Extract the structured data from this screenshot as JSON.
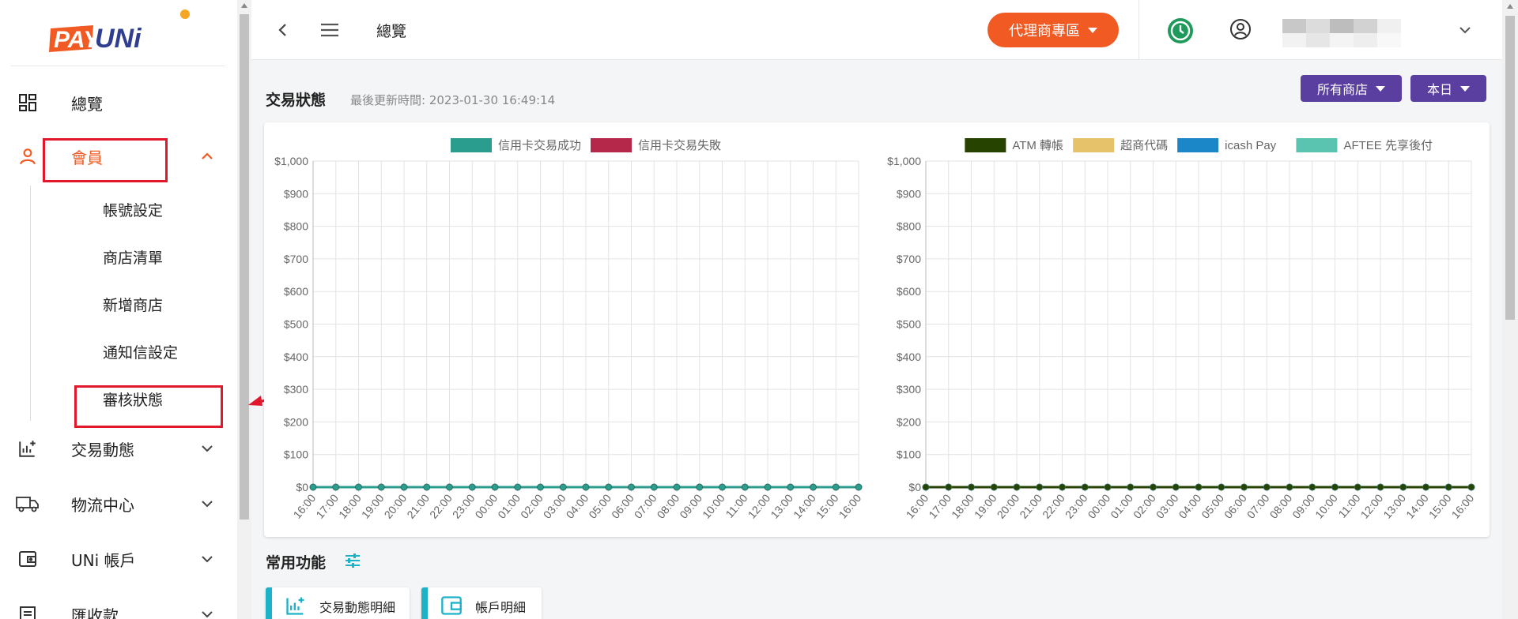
{
  "brand": {
    "logo_text_pay": "PAY",
    "logo_text_uni": "UNi"
  },
  "sidebar": {
    "items": [
      {
        "label": "總覽",
        "icon": "dashboard-icon"
      },
      {
        "label": "會員",
        "icon": "user-icon",
        "active": true,
        "expanded": true
      },
      {
        "label": "交易動態",
        "icon": "chart-add-icon"
      },
      {
        "label": "物流中心",
        "icon": "truck-icon"
      },
      {
        "label": "UNi 帳戶",
        "icon": "wallet-icon"
      },
      {
        "label": "匯收款",
        "icon": "receipt-icon"
      }
    ],
    "sub_items": [
      "帳號設定",
      "商店清單",
      "新增商店",
      "通知信設定",
      "審核狀態"
    ]
  },
  "header": {
    "title": "總覽",
    "agent_button": "代理商專區"
  },
  "status": {
    "title": "交易狀態",
    "update_time": "最後更新時間: 2023-01-30 16:49:14",
    "store_filter": "所有商店",
    "date_filter": "本日"
  },
  "colors": {
    "accent": "#f15a22",
    "purple": "#5b3fa0",
    "annotation": "#e1182b",
    "cyan": "#1cb3c8"
  },
  "chart_data": [
    {
      "type": "line",
      "x": [
        "16:00",
        "17:00",
        "18:00",
        "19:00",
        "20:00",
        "21:00",
        "22:00",
        "23:00",
        "00:00",
        "01:00",
        "02:00",
        "03:00",
        "04:00",
        "05:00",
        "06:00",
        "07:00",
        "08:00",
        "09:00",
        "10:00",
        "11:00",
        "12:00",
        "13:00",
        "14:00",
        "15:00",
        "16:00"
      ],
      "ylim": [
        0,
        1000
      ],
      "yticks": [
        "$0",
        "$100",
        "$200",
        "$300",
        "$400",
        "$500",
        "$600",
        "$700",
        "$800",
        "$900",
        "$1,000"
      ],
      "legend_position": "top",
      "series": [
        {
          "name": "信用卡交易成功",
          "color": "#2a9d8f",
          "values": [
            0,
            0,
            0,
            0,
            0,
            0,
            0,
            0,
            0,
            0,
            0,
            0,
            0,
            0,
            0,
            0,
            0,
            0,
            0,
            0,
            0,
            0,
            0,
            0,
            0
          ]
        },
        {
          "name": "信用卡交易失敗",
          "color": "#b5284a",
          "values": [
            0,
            0,
            0,
            0,
            0,
            0,
            0,
            0,
            0,
            0,
            0,
            0,
            0,
            0,
            0,
            0,
            0,
            0,
            0,
            0,
            0,
            0,
            0,
            0,
            0
          ]
        }
      ],
      "grid": true
    },
    {
      "type": "line",
      "x": [
        "16:00",
        "17:00",
        "18:00",
        "19:00",
        "20:00",
        "21:00",
        "22:00",
        "23:00",
        "00:00",
        "01:00",
        "02:00",
        "03:00",
        "04:00",
        "05:00",
        "06:00",
        "07:00",
        "08:00",
        "09:00",
        "10:00",
        "11:00",
        "12:00",
        "13:00",
        "14:00",
        "15:00",
        "16:00"
      ],
      "ylim": [
        0,
        1000
      ],
      "yticks": [
        "$0",
        "$100",
        "$200",
        "$300",
        "$400",
        "$500",
        "$600",
        "$700",
        "$800",
        "$900",
        "$1,000"
      ],
      "legend_position": "top",
      "series": [
        {
          "name": "ATM 轉帳",
          "color": "#264300",
          "values": [
            0,
            0,
            0,
            0,
            0,
            0,
            0,
            0,
            0,
            0,
            0,
            0,
            0,
            0,
            0,
            0,
            0,
            0,
            0,
            0,
            0,
            0,
            0,
            0,
            0
          ]
        },
        {
          "name": "超商代碼",
          "color": "#e6c36a",
          "values": [
            0,
            0,
            0,
            0,
            0,
            0,
            0,
            0,
            0,
            0,
            0,
            0,
            0,
            0,
            0,
            0,
            0,
            0,
            0,
            0,
            0,
            0,
            0,
            0,
            0
          ]
        },
        {
          "name": "icash Pay",
          "color": "#1b87c9",
          "values": [
            0,
            0,
            0,
            0,
            0,
            0,
            0,
            0,
            0,
            0,
            0,
            0,
            0,
            0,
            0,
            0,
            0,
            0,
            0,
            0,
            0,
            0,
            0,
            0,
            0
          ]
        },
        {
          "name": "AFTEE 先享後付",
          "color": "#5bc4b0",
          "values": [
            0,
            0,
            0,
            0,
            0,
            0,
            0,
            0,
            0,
            0,
            0,
            0,
            0,
            0,
            0,
            0,
            0,
            0,
            0,
            0,
            0,
            0,
            0,
            0,
            0
          ]
        }
      ],
      "grid": true
    }
  ],
  "favorites": {
    "title": "常用功能",
    "items": [
      {
        "label": "交易動態明細",
        "icon": "chart-add-icon"
      },
      {
        "label": "帳戶明細",
        "icon": "wallet-icon"
      }
    ]
  }
}
